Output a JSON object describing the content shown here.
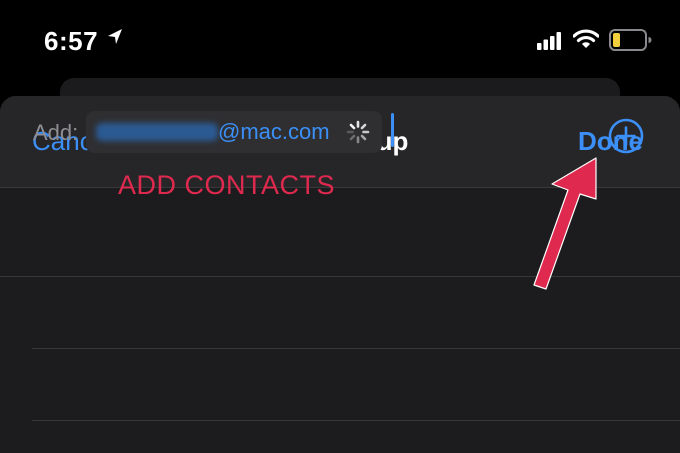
{
  "status_bar": {
    "time": "6:57",
    "icons": [
      "location-arrow-icon",
      "cellular-signal-icon",
      "wifi-icon",
      "battery-low-icon"
    ]
  },
  "nav": {
    "cancel_label": "Cancel",
    "title": "Test Group",
    "done_label": "Done"
  },
  "add_field": {
    "label": "Add:",
    "recipient_visible_text": "@mac.com",
    "add_button_icon": "plus-circle-icon"
  },
  "annotation": {
    "text": "ADD CONTACTS"
  },
  "colors": {
    "accent": "#3b8ff6",
    "annotation_red": "#e0294f",
    "sheet_bg": "#1c1c1e",
    "nav_bg": "#262628",
    "battery_yellow": "#f4d03f"
  }
}
